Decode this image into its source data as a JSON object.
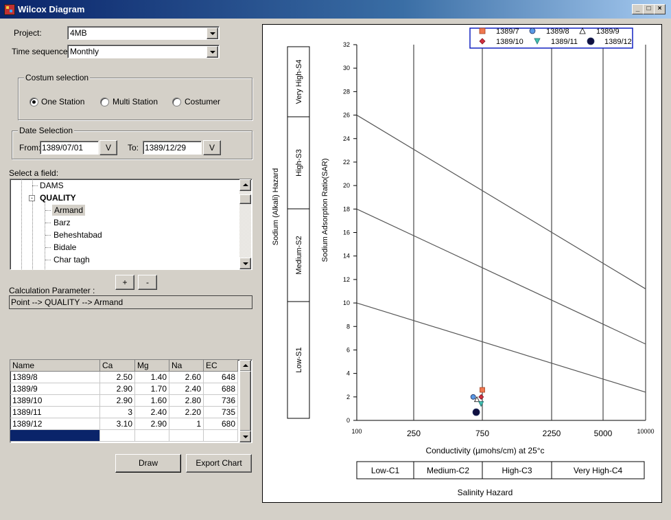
{
  "window": {
    "title": "Wilcox Diagram"
  },
  "form": {
    "project_label": "Project:",
    "project_value": "4MB",
    "time_label": "Time sequence:",
    "time_value": "Monthly",
    "custom_group_title": "Costum selection",
    "radios": [
      "One Station",
      "Multi Station",
      "Costumer"
    ],
    "date_group_title": "Date Selection",
    "from_label": "From:",
    "from_value": "1389/07/01",
    "to_label": "To:",
    "to_value": "1389/12/29",
    "v_label": "V",
    "field_label": "Select a field:",
    "tree": {
      "dams": "DAMS",
      "quality": "QUALITY",
      "items": [
        "Armand",
        "Barz",
        "Beheshtabad",
        "Bidale",
        "Char tagh"
      ]
    },
    "plus": "+",
    "minus": "-",
    "calc_label": "Calculation Parameter :",
    "calc_value": "Point --> QUALITY --> Armand",
    "draw_button": "Draw",
    "export_button": "Export Chart"
  },
  "grid": {
    "headers": [
      "Name",
      "Ca",
      "Mg",
      "Na",
      "EC"
    ],
    "rows": [
      [
        "1389/8",
        "2.50",
        "1.40",
        "2.60",
        "648"
      ],
      [
        "1389/9",
        "2.90",
        "1.70",
        "2.40",
        "688"
      ],
      [
        "1389/10",
        "2.90",
        "1.60",
        "2.80",
        "736"
      ],
      [
        "1389/11",
        "3",
        "2.40",
        "2.20",
        "735"
      ],
      [
        "1389/12",
        "3.10",
        "2.90",
        "1",
        "680"
      ]
    ]
  },
  "chart_data": {
    "type": "scatter",
    "xlabel": "Conductivity (µmohs/cm) at 25°c",
    "ylabel": "Sodium Adsorption Ratio(SAR)",
    "x_ticks": [
      "100",
      "250",
      "750",
      "2250",
      "5000",
      "10000"
    ],
    "y_ticks": [
      "0",
      "2",
      "4",
      "6",
      "8",
      "10",
      "12",
      "14",
      "16",
      "18",
      "20",
      "22",
      "24",
      "26",
      "28",
      "30",
      "32"
    ],
    "ylim": [
      0,
      32
    ],
    "legend_position": "top-right",
    "alkali_label": "Sodium (Alkali) Hazard",
    "alkali_zones": [
      "Very High-S4",
      "High-S3",
      "Medium-S2",
      "Low-S1"
    ],
    "salinity_label": "Salinity Hazard",
    "salinity_zones": [
      "Low-C1",
      "Medium-C2",
      "High-C3",
      "Very High-C4"
    ],
    "boundary_lines": [
      {
        "from": [
          "100",
          26
        ],
        "to": [
          "10000",
          11.2
        ]
      },
      {
        "from": [
          "100",
          18
        ],
        "to": [
          "10000",
          6.5
        ]
      },
      {
        "from": [
          "100",
          10
        ],
        "to": [
          "10000",
          2.4
        ]
      }
    ],
    "series": [
      {
        "name": "1389/7",
        "marker": "square",
        "color": "#f07850",
        "x": 750,
        "y": 2.6
      },
      {
        "name": "1389/8",
        "marker": "circle",
        "color": "#5a9ae6",
        "x": 648,
        "y": 2.0
      },
      {
        "name": "1389/9",
        "marker": "triangle-up",
        "color": "#ffffff",
        "x": 688,
        "y": 1.8
      },
      {
        "name": "1389/10",
        "marker": "diamond",
        "color": "#d03040",
        "x": 736,
        "y": 2.0
      },
      {
        "name": "1389/11",
        "marker": "triangle-down",
        "color": "#40c0b0",
        "x": 735,
        "y": 1.4
      },
      {
        "name": "1389/12",
        "marker": "circle",
        "color": "#101040",
        "x": 680,
        "y": 0.7
      }
    ]
  }
}
